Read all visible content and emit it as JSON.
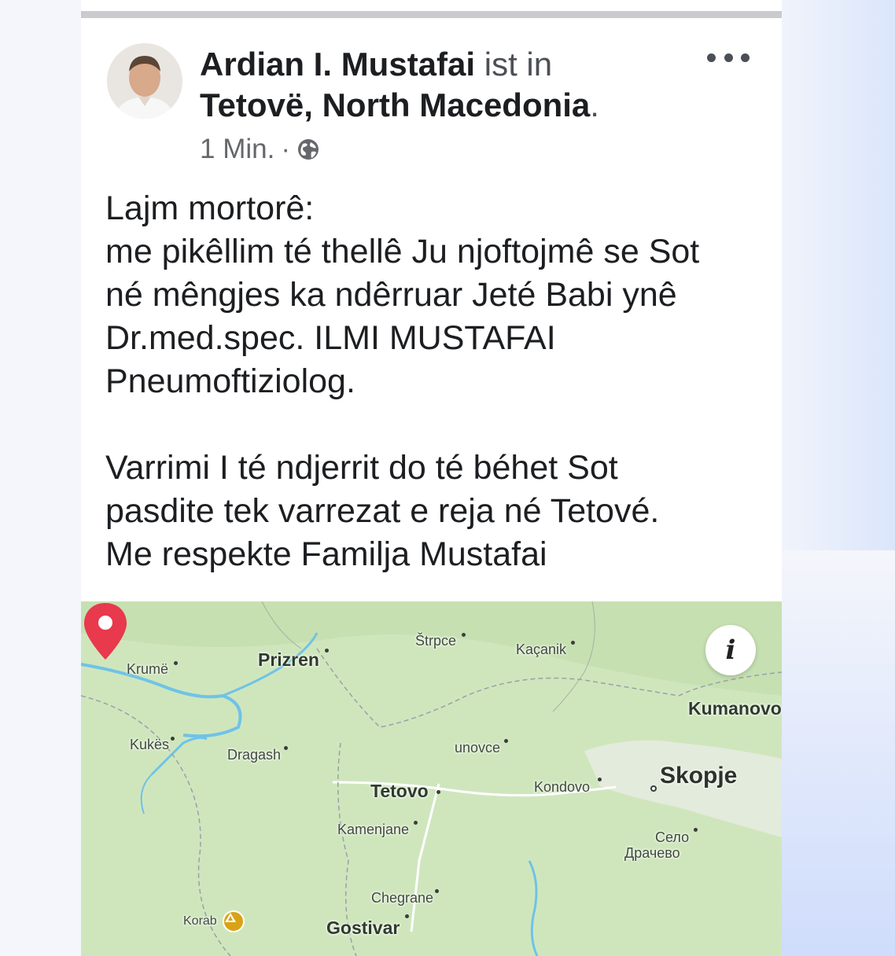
{
  "post": {
    "author": "Ardian I. Mustafai",
    "location_connector": "ist in",
    "location": "Tetovë, North Macedonia",
    "location_suffix": ".",
    "time": "1 Min.",
    "separator": "·",
    "audience_icon": "globe-icon",
    "more_icon": "more-dots-icon",
    "text_lines": [
      "Lajm mortorê:",
      "me pikêllim té thellê Ju njoftojmê se Sot",
      "né mêngjes ka ndêrruar Jeté Babi ynê",
      "Dr.med.spec. ILMI MUSTAFAI",
      "Pneumoftiziolog."
    ],
    "text_lines_2": [
      "Varrimi I té ndjerrit do té béhet Sot",
      "pasdite tek varrezat e reja né Tetové.",
      "Me respekte Familja Mustafai"
    ]
  },
  "map": {
    "info_icon": "info-icon",
    "info_glyph": "i",
    "pin_icon": "location-pin-icon",
    "places": {
      "krume": "Krumë",
      "prizren": "Prizren",
      "strpce": "Štrpce",
      "kacanik": "Kaçanik",
      "kumanovo": "Kumanovo",
      "kukes": "Kukës",
      "dragash": "Dragash",
      "jegunovce": "unovce",
      "tetovo": "Tetovo",
      "kondovo": "Kondovo",
      "skopje": "Skopje",
      "kamenjane": "Kamenjane",
      "selo": "Село",
      "dracevo": "Драчево",
      "chegrane": "Chegrane",
      "korab": "Korab",
      "gostivar": "Gostivar"
    },
    "colors": {
      "land": "#cfe6bd",
      "water": "#6fc3e6",
      "urban": "#e9ede6",
      "pin": "#e8394d"
    }
  }
}
